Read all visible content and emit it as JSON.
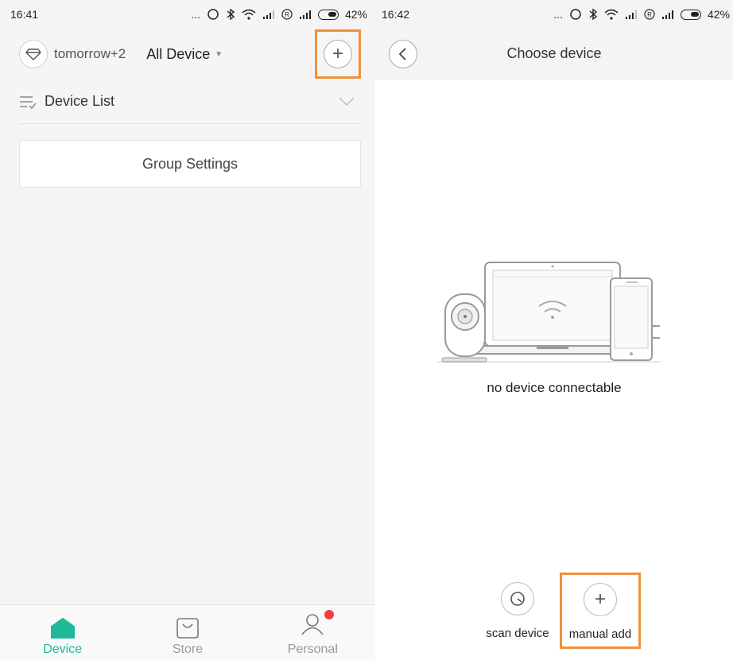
{
  "left": {
    "status": {
      "time": "16:41",
      "dots": "...",
      "battery": "42%"
    },
    "topbar": {
      "user": "tomorrow+2",
      "filter": "All Device",
      "add_symbol": "+"
    },
    "device_list": {
      "label": "Device List"
    },
    "group_card": {
      "label": "Group Settings"
    },
    "tabs": [
      {
        "label": "Device",
        "icon": "home-icon",
        "active": true
      },
      {
        "label": "Store",
        "icon": "bag-icon",
        "active": false
      },
      {
        "label": "Personal",
        "icon": "person-icon",
        "active": false
      }
    ]
  },
  "right": {
    "status": {
      "time": "16:42",
      "dots": "...",
      "battery": "42%"
    },
    "nav": {
      "title": "Choose device"
    },
    "empty_text": "no device connectable",
    "actions": {
      "scan_label": "scan device",
      "manual_label": "manual add",
      "manual_symbol": "+"
    }
  },
  "colors": {
    "accent": "#1fb99a",
    "highlight": "#f0913a",
    "badge": "#f33f3f",
    "left_bg": "#f5f5f5"
  }
}
